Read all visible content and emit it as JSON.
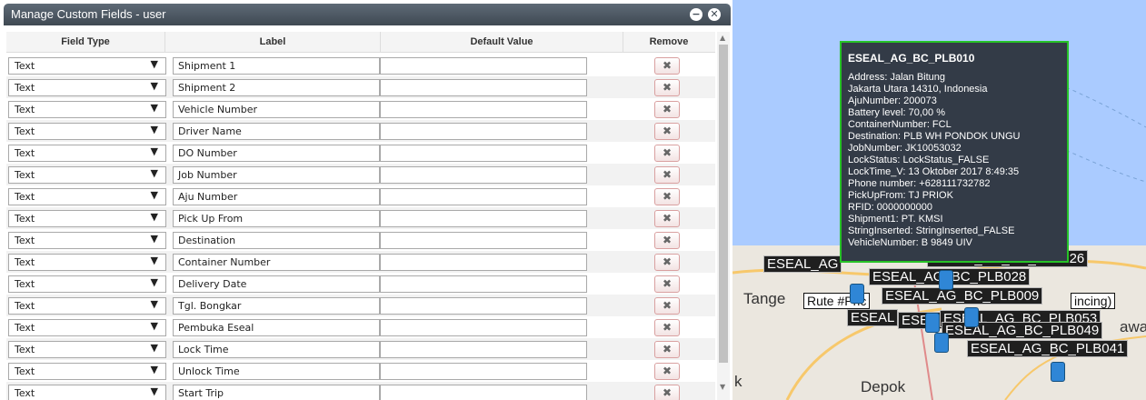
{
  "dialog": {
    "title": "Manage Custom Fields - user",
    "minimize_glyph": "−",
    "close_glyph": "✕",
    "columns": {
      "field_type": "Field Type",
      "label": "Label",
      "default_value": "Default Value",
      "remove": "Remove"
    },
    "remove_glyph": "✖",
    "select_arrow": "▼",
    "rows": [
      {
        "type": "Text",
        "label": "Shipment 1",
        "default": ""
      },
      {
        "type": "Text",
        "label": "Shipment 2",
        "default": ""
      },
      {
        "type": "Text",
        "label": "Vehicle Number",
        "default": ""
      },
      {
        "type": "Text",
        "label": "Driver Name",
        "default": ""
      },
      {
        "type": "Text",
        "label": "DO Number",
        "default": ""
      },
      {
        "type": "Text",
        "label": "Job Number",
        "default": ""
      },
      {
        "type": "Text",
        "label": "Aju Number",
        "default": ""
      },
      {
        "type": "Text",
        "label": "Pick Up From",
        "default": ""
      },
      {
        "type": "Text",
        "label": "Destination",
        "default": ""
      },
      {
        "type": "Text",
        "label": "Container Number",
        "default": ""
      },
      {
        "type": "Text",
        "label": "Delivery Date",
        "default": ""
      },
      {
        "type": "Text",
        "label": "Tgl. Bongkar",
        "default": ""
      },
      {
        "type": "Text",
        "label": "Pembuka Eseal",
        "default": ""
      },
      {
        "type": "Text",
        "label": "Lock Time",
        "default": ""
      },
      {
        "type": "Text",
        "label": "Unlock Time",
        "default": ""
      },
      {
        "type": "Text",
        "label": "Start Trip",
        "default": ""
      }
    ]
  },
  "map": {
    "tooltip": {
      "title": "ESEAL_AG_BC_PLB010",
      "lines": [
        "Address: Jalan Bitung",
        "Jakarta Utara 14310, Indonesia",
        "AjuNumber: 200073",
        "Battery level: 70,00 %",
        "ContainerNumber: FCL",
        "Destination: PLB WH PONDOK UNGU",
        "JobNumber: JK10053032",
        "LockStatus: LockStatus_FALSE",
        "LockTime_V: 13 Oktober 2017 8:49:35",
        "Phone number: +628111732782",
        "PickUpFrom: TJ PRIOK",
        "RFID: 0000000000",
        "Shipment1: PT. KMSI",
        "StringInserted: StringInserted_FALSE",
        "VehicleNumber: B 9849 UIV"
      ]
    },
    "labels": [
      "ESEAL_AG",
      "ESEAL_AG_BC_PLB026",
      "ESEAL_AG_BC_PLB028",
      "ESEAL_AG_BC_PLB009",
      "ESEAL",
      "ESEAL",
      "ESEAL_AG_BC_PLB053",
      "ESEAL_AG_BC_PLB049",
      "ESEAL_AG_BC_PLB041"
    ],
    "route_prefix": "Rute #Pric",
    "route_suffix": "incing)",
    "towns": [
      "Tange",
      "Depok",
      "k",
      "awa"
    ]
  },
  "colors": {
    "titlebar": "#4a5560",
    "tooltip_bg": "#333b47",
    "tooltip_border": "#27c227",
    "pin": "#2f86d6"
  }
}
